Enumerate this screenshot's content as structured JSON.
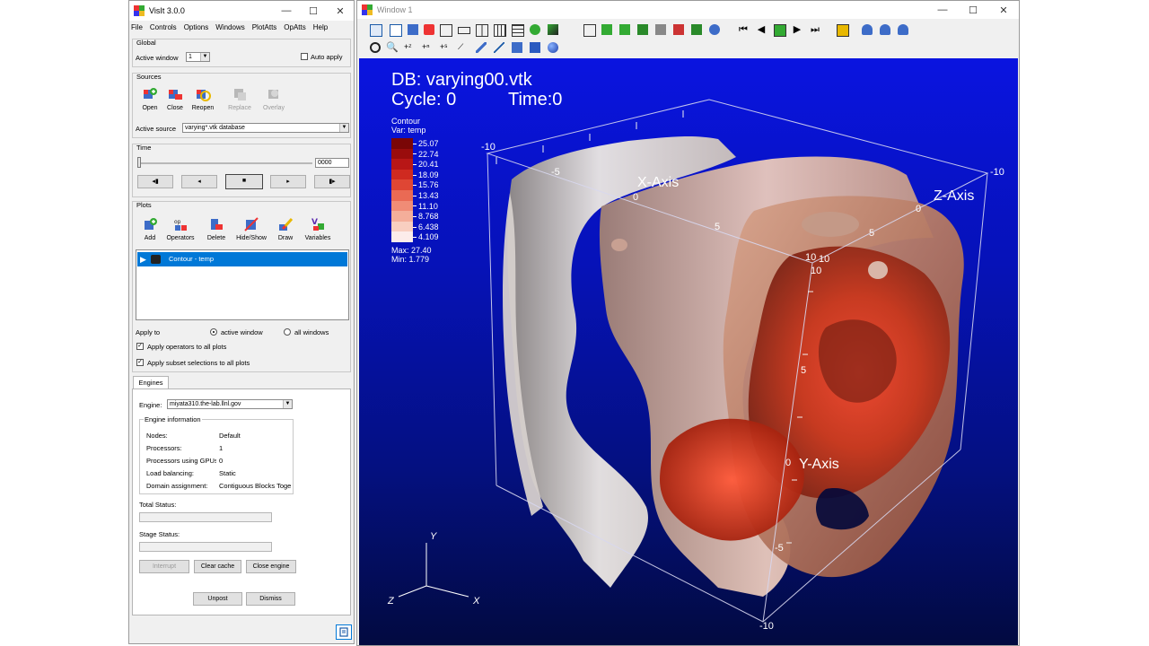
{
  "control": {
    "title": "VisIt 3.0.0",
    "menu": [
      "File",
      "Controls",
      "Options",
      "Windows",
      "PlotAtts",
      "OpAtts",
      "Help"
    ],
    "global": {
      "group_title": "Global",
      "active_window_label": "Active window",
      "active_window_value": "1",
      "auto_apply_label": "Auto apply",
      "auto_apply_checked": false
    },
    "sources": {
      "group_title": "Sources",
      "buttons": [
        "Open",
        "Close",
        "Reopen",
        "Replace",
        "Overlay"
      ],
      "active_source_label": "Active source",
      "active_source_value": "varying*.vtk database"
    },
    "time": {
      "group_title": "Time",
      "frame_value": "0000",
      "button_glyphs": [
        "◂▮",
        "◂",
        "■",
        "▸",
        "▮▸"
      ]
    },
    "plots": {
      "group_title": "Plots",
      "buttons": [
        "Add",
        "Operators",
        "Delete",
        "Hide/Show",
        "Draw",
        "Variables"
      ],
      "list_item": "Contour - temp",
      "apply_to_label": "Apply to",
      "active_window_option": "active window",
      "all_windows_option": "all windows",
      "apply_operators_label": "Apply operators to all plots",
      "apply_subset_label": "Apply subset selections to all plots"
    },
    "engines": {
      "tab_label": "Engines",
      "engine_label": "Engine:",
      "engine_value": "miyata310.the-lab.llnl.gov",
      "info_title": "Engine information",
      "info_rows": [
        {
          "key": "Nodes:",
          "value": "Default"
        },
        {
          "key": "Processors:",
          "value": "1"
        },
        {
          "key": "Processors using GPUs:",
          "value": "0"
        },
        {
          "key": "Load balancing:",
          "value": "Static"
        },
        {
          "key": "Domain assignment:",
          "value": "Contiguous Blocks Together"
        }
      ],
      "total_status_label": "Total Status:",
      "stage_status_label": "Stage Status:",
      "interrupt_label": "Interrupt",
      "clear_cache_label": "Clear cache",
      "close_engine_label": "Close engine",
      "unpost_label": "Unpost",
      "dismiss_label": "Dismiss"
    }
  },
  "viewer": {
    "title": "Window 1",
    "db_line": "DB: varying00.vtk",
    "cycle_line": "Cycle: 0",
    "time_line": "Time:0",
    "legend": {
      "title": "Contour",
      "var": "Var: temp",
      "levels": [
        "25.07",
        "22.74",
        "20.41",
        "18.09",
        "15.76",
        "13.43",
        "11.10",
        "8.768",
        "6.438",
        "4.109"
      ],
      "colors": [
        "#7a0606",
        "#9a0c0c",
        "#b81616",
        "#cf2a20",
        "#df4634",
        "#ea6a54",
        "#f08c76",
        "#f4ae9a",
        "#f8cec0",
        "#fcecea"
      ],
      "max": "Max: 27.40",
      "min": "Min: 1.779"
    },
    "axes": {
      "x_title": "X-Axis",
      "y_title": "Y-Axis",
      "z_title": "Z-Axis",
      "x_ticks": [
        "-10",
        "-5",
        "0",
        "5",
        "10"
      ],
      "y_ticks": [
        "10",
        "5",
        "0",
        "-5",
        "-10"
      ],
      "z_ticks": [
        "10",
        "5",
        "0",
        "-10"
      ],
      "triad": {
        "x": "X",
        "y": "Y",
        "z": "Z"
      }
    },
    "background_top": "#0a14e0",
    "background_bottom": "#020a40"
  }
}
